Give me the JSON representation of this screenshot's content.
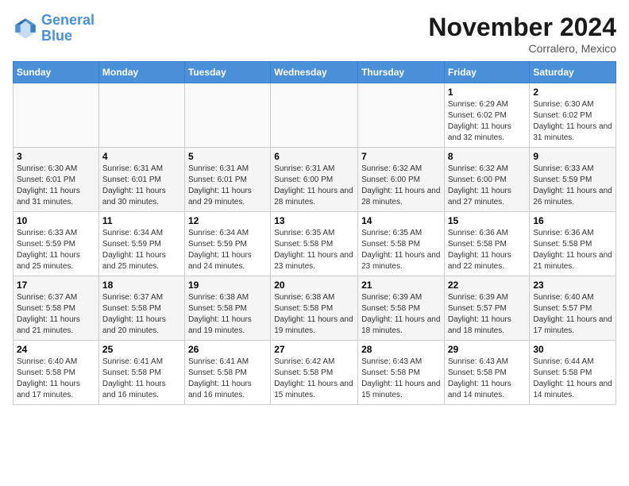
{
  "header": {
    "logo_line1": "General",
    "logo_line2": "Blue",
    "month_year": "November 2024",
    "location": "Corralero, Mexico"
  },
  "weekdays": [
    "Sunday",
    "Monday",
    "Tuesday",
    "Wednesday",
    "Thursday",
    "Friday",
    "Saturday"
  ],
  "weeks": [
    [
      {
        "day": "",
        "sunrise": "",
        "sunset": "",
        "daylight": ""
      },
      {
        "day": "",
        "sunrise": "",
        "sunset": "",
        "daylight": ""
      },
      {
        "day": "",
        "sunrise": "",
        "sunset": "",
        "daylight": ""
      },
      {
        "day": "",
        "sunrise": "",
        "sunset": "",
        "daylight": ""
      },
      {
        "day": "",
        "sunrise": "",
        "sunset": "",
        "daylight": ""
      },
      {
        "day": "1",
        "sunrise": "Sunrise: 6:29 AM",
        "sunset": "Sunset: 6:02 PM",
        "daylight": "Daylight: 11 hours and 32 minutes."
      },
      {
        "day": "2",
        "sunrise": "Sunrise: 6:30 AM",
        "sunset": "Sunset: 6:02 PM",
        "daylight": "Daylight: 11 hours and 31 minutes."
      }
    ],
    [
      {
        "day": "3",
        "sunrise": "Sunrise: 6:30 AM",
        "sunset": "Sunset: 6:01 PM",
        "daylight": "Daylight: 11 hours and 31 minutes."
      },
      {
        "day": "4",
        "sunrise": "Sunrise: 6:31 AM",
        "sunset": "Sunset: 6:01 PM",
        "daylight": "Daylight: 11 hours and 30 minutes."
      },
      {
        "day": "5",
        "sunrise": "Sunrise: 6:31 AM",
        "sunset": "Sunset: 6:01 PM",
        "daylight": "Daylight: 11 hours and 29 minutes."
      },
      {
        "day": "6",
        "sunrise": "Sunrise: 6:31 AM",
        "sunset": "Sunset: 6:00 PM",
        "daylight": "Daylight: 11 hours and 28 minutes."
      },
      {
        "day": "7",
        "sunrise": "Sunrise: 6:32 AM",
        "sunset": "Sunset: 6:00 PM",
        "daylight": "Daylight: 11 hours and 28 minutes."
      },
      {
        "day": "8",
        "sunrise": "Sunrise: 6:32 AM",
        "sunset": "Sunset: 6:00 PM",
        "daylight": "Daylight: 11 hours and 27 minutes."
      },
      {
        "day": "9",
        "sunrise": "Sunrise: 6:33 AM",
        "sunset": "Sunset: 5:59 PM",
        "daylight": "Daylight: 11 hours and 26 minutes."
      }
    ],
    [
      {
        "day": "10",
        "sunrise": "Sunrise: 6:33 AM",
        "sunset": "Sunset: 5:59 PM",
        "daylight": "Daylight: 11 hours and 25 minutes."
      },
      {
        "day": "11",
        "sunrise": "Sunrise: 6:34 AM",
        "sunset": "Sunset: 5:59 PM",
        "daylight": "Daylight: 11 hours and 25 minutes."
      },
      {
        "day": "12",
        "sunrise": "Sunrise: 6:34 AM",
        "sunset": "Sunset: 5:59 PM",
        "daylight": "Daylight: 11 hours and 24 minutes."
      },
      {
        "day": "13",
        "sunrise": "Sunrise: 6:35 AM",
        "sunset": "Sunset: 5:58 PM",
        "daylight": "Daylight: 11 hours and 23 minutes."
      },
      {
        "day": "14",
        "sunrise": "Sunrise: 6:35 AM",
        "sunset": "Sunset: 5:58 PM",
        "daylight": "Daylight: 11 hours and 23 minutes."
      },
      {
        "day": "15",
        "sunrise": "Sunrise: 6:36 AM",
        "sunset": "Sunset: 5:58 PM",
        "daylight": "Daylight: 11 hours and 22 minutes."
      },
      {
        "day": "16",
        "sunrise": "Sunrise: 6:36 AM",
        "sunset": "Sunset: 5:58 PM",
        "daylight": "Daylight: 11 hours and 21 minutes."
      }
    ],
    [
      {
        "day": "17",
        "sunrise": "Sunrise: 6:37 AM",
        "sunset": "Sunset: 5:58 PM",
        "daylight": "Daylight: 11 hours and 21 minutes."
      },
      {
        "day": "18",
        "sunrise": "Sunrise: 6:37 AM",
        "sunset": "Sunset: 5:58 PM",
        "daylight": "Daylight: 11 hours and 20 minutes."
      },
      {
        "day": "19",
        "sunrise": "Sunrise: 6:38 AM",
        "sunset": "Sunset: 5:58 PM",
        "daylight": "Daylight: 11 hours and 19 minutes."
      },
      {
        "day": "20",
        "sunrise": "Sunrise: 6:38 AM",
        "sunset": "Sunset: 5:58 PM",
        "daylight": "Daylight: 11 hours and 19 minutes."
      },
      {
        "day": "21",
        "sunrise": "Sunrise: 6:39 AM",
        "sunset": "Sunset: 5:58 PM",
        "daylight": "Daylight: 11 hours and 18 minutes."
      },
      {
        "day": "22",
        "sunrise": "Sunrise: 6:39 AM",
        "sunset": "Sunset: 5:57 PM",
        "daylight": "Daylight: 11 hours and 18 minutes."
      },
      {
        "day": "23",
        "sunrise": "Sunrise: 6:40 AM",
        "sunset": "Sunset: 5:57 PM",
        "daylight": "Daylight: 11 hours and 17 minutes."
      }
    ],
    [
      {
        "day": "24",
        "sunrise": "Sunrise: 6:40 AM",
        "sunset": "Sunset: 5:58 PM",
        "daylight": "Daylight: 11 hours and 17 minutes."
      },
      {
        "day": "25",
        "sunrise": "Sunrise: 6:41 AM",
        "sunset": "Sunset: 5:58 PM",
        "daylight": "Daylight: 11 hours and 16 minutes."
      },
      {
        "day": "26",
        "sunrise": "Sunrise: 6:41 AM",
        "sunset": "Sunset: 5:58 PM",
        "daylight": "Daylight: 11 hours and 16 minutes."
      },
      {
        "day": "27",
        "sunrise": "Sunrise: 6:42 AM",
        "sunset": "Sunset: 5:58 PM",
        "daylight": "Daylight: 11 hours and 15 minutes."
      },
      {
        "day": "28",
        "sunrise": "Sunrise: 6:43 AM",
        "sunset": "Sunset: 5:58 PM",
        "daylight": "Daylight: 11 hours and 15 minutes."
      },
      {
        "day": "29",
        "sunrise": "Sunrise: 6:43 AM",
        "sunset": "Sunset: 5:58 PM",
        "daylight": "Daylight: 11 hours and 14 minutes."
      },
      {
        "day": "30",
        "sunrise": "Sunrise: 6:44 AM",
        "sunset": "Sunset: 5:58 PM",
        "daylight": "Daylight: 11 hours and 14 minutes."
      }
    ]
  ]
}
